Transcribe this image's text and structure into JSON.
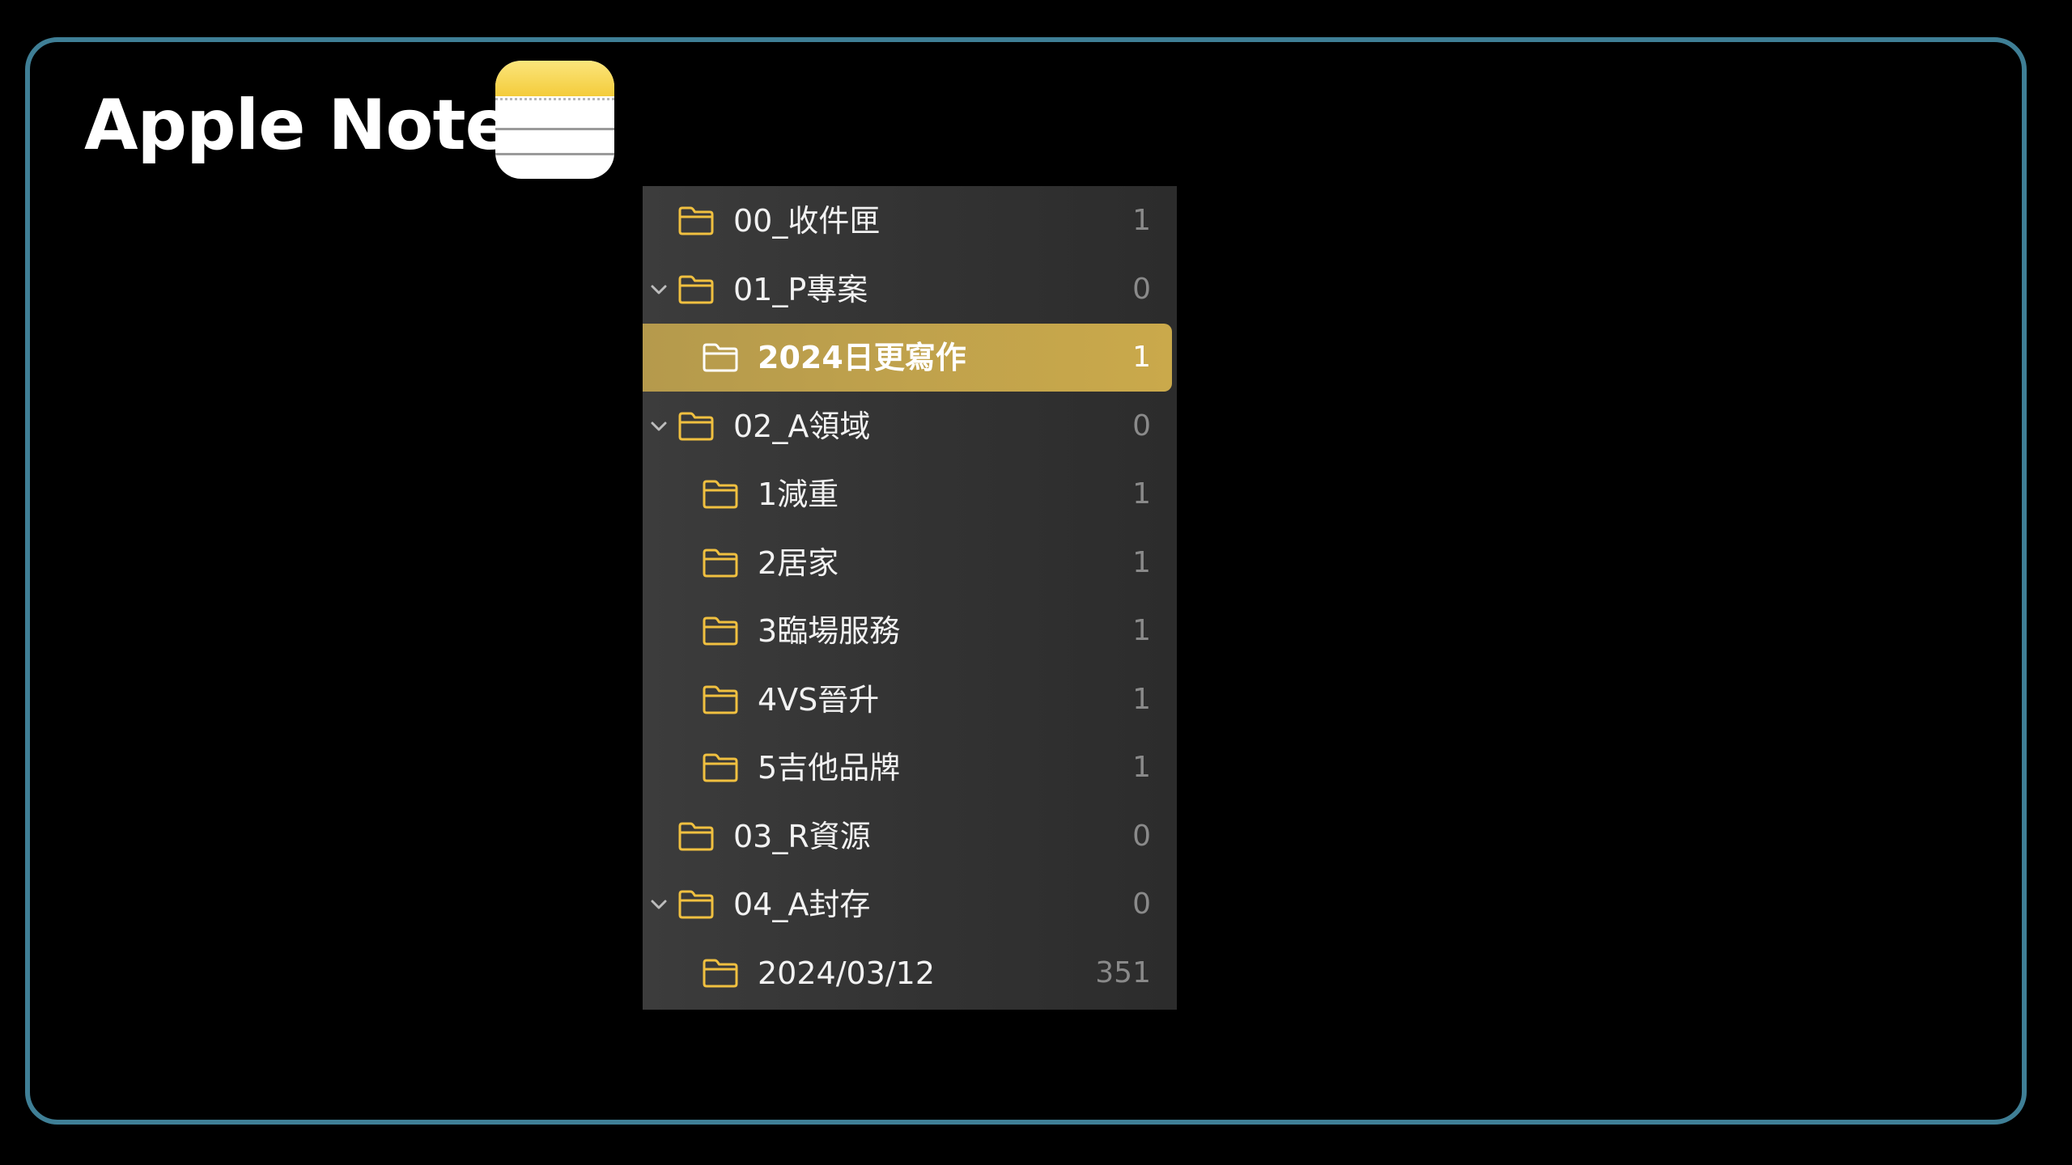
{
  "title": "Apple Note",
  "icon": "apple-notes-app-icon",
  "colors": {
    "frame_border": "#3f7f96",
    "folder_icon": "#f0c040",
    "selected_row": "#c2a34b"
  },
  "folders": [
    {
      "label": "00_收件匣",
      "count": "1",
      "level": 0,
      "expanded": false,
      "selected": false
    },
    {
      "label": "01_P專案",
      "count": "0",
      "level": 0,
      "expanded": true,
      "selected": false
    },
    {
      "label": "2024日更寫作",
      "count": "1",
      "level": 1,
      "expanded": false,
      "selected": true
    },
    {
      "label": "02_A領域",
      "count": "0",
      "level": 0,
      "expanded": true,
      "selected": false
    },
    {
      "label": "1減重",
      "count": "1",
      "level": 1,
      "expanded": false,
      "selected": false
    },
    {
      "label": "2居家",
      "count": "1",
      "level": 1,
      "expanded": false,
      "selected": false
    },
    {
      "label": "3臨場服務",
      "count": "1",
      "level": 1,
      "expanded": false,
      "selected": false
    },
    {
      "label": "4VS晉升",
      "count": "1",
      "level": 1,
      "expanded": false,
      "selected": false
    },
    {
      "label": "5吉他品牌",
      "count": "1",
      "level": 1,
      "expanded": false,
      "selected": false
    },
    {
      "label": "03_R資源",
      "count": "0",
      "level": 0,
      "expanded": false,
      "selected": false
    },
    {
      "label": "04_A封存",
      "count": "0",
      "level": 0,
      "expanded": true,
      "selected": false
    },
    {
      "label": "2024/03/12",
      "count": "351",
      "level": 1,
      "expanded": false,
      "selected": false
    }
  ]
}
